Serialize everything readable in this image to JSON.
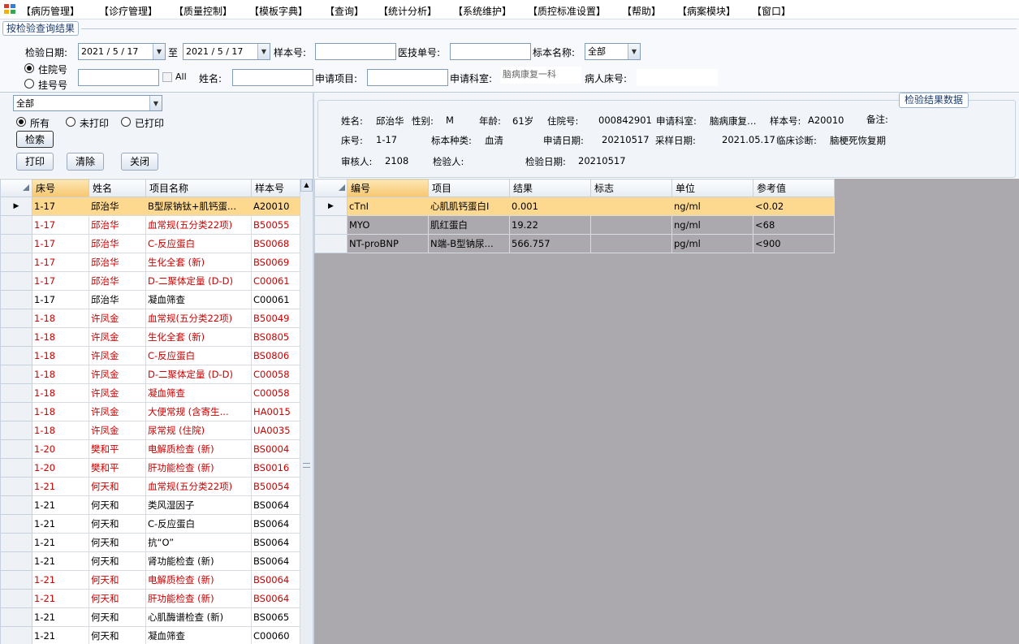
{
  "menu": [
    "【病历管理】",
    "【诊疗管理】",
    "【质量控制】",
    "【模板字典】",
    "【查询】",
    "【统计分析】",
    "【系统维护】",
    "【质控标准设置】",
    "【帮助】",
    "【病案模块】",
    "【窗口】"
  ],
  "query": {
    "group_title": "按检验查询结果",
    "date_label": "检验日期:",
    "date_from": "2021 / 5 / 17",
    "to_label": "至",
    "date_to": "2021 / 5 / 17",
    "sample_no_label": "样本号:",
    "sample_no_value": "",
    "tech_no_label": "医技单号:",
    "tech_no_value": "",
    "specimen_label": "标本名称:",
    "specimen_value": "全部",
    "inpatient_label": "住院号",
    "register_label": "挂号号",
    "all_label": "All",
    "name_label": "姓名:",
    "name_value": "",
    "apply_item_label": "申请项目:",
    "apply_item_value": "",
    "apply_dept_label": "申请科室:",
    "apply_dept_value": "脑病康复一科",
    "bed_label": "病人床号:",
    "bed_value": ""
  },
  "filter": {
    "combo_value": "全部",
    "all_label": "所有",
    "unprinted_label": "未打印",
    "printed_label": "已打印",
    "search_button": "检索",
    "print_button": "打印",
    "clear_button": "清除",
    "close_button": "关闭"
  },
  "detail": {
    "title": "检验结果数据",
    "name_label": "姓名:",
    "name": "邱治华",
    "sex_label": "性别:",
    "sex": "M",
    "age_label": "年龄:",
    "age": "61岁",
    "inpatient_label": "住院号:",
    "inpatient": "000842901",
    "dept_label": "申请科室:",
    "dept": "脑病康复…",
    "sample_label": "样本号:",
    "sample": "A20010",
    "remark_label": "备注:",
    "bed_label": "床号:",
    "bed": "1-17",
    "specimen_label": "标本种类:",
    "specimen": "血清",
    "apply_date_label": "申请日期:",
    "apply_date": "20210517",
    "collect_date_label": "采样日期:",
    "collect_date": "2021.05.17",
    "diagnosis_label": "临床诊断:",
    "diagnosis": "脑梗死恢复期",
    "reviewer_label": "审核人:",
    "reviewer": "2108",
    "tester_label": "检验人:",
    "tester": "",
    "test_date_label": "检验日期:",
    "test_date": "20210517"
  },
  "left_grid": {
    "columns": [
      "床号",
      "姓名",
      "项目名称",
      "样本号"
    ],
    "rows": [
      {
        "bed": "1-17",
        "name": "邱治华",
        "item": "B型尿钠钛+肌钙蛋...",
        "sample": "A20010",
        "red": false,
        "current": true
      },
      {
        "bed": "1-17",
        "name": "邱治华",
        "item": "血常规(五分类22项)",
        "sample": "B50055",
        "red": true
      },
      {
        "bed": "1-17",
        "name": "邱治华",
        "item": "C-反应蛋白",
        "sample": "BS0068",
        "red": true
      },
      {
        "bed": "1-17",
        "name": "邱治华",
        "item": "生化全套 (新)",
        "sample": "BS0069",
        "red": true
      },
      {
        "bed": "1-17",
        "name": "邱治华",
        "item": "D-二聚体定量 (D-D)",
        "sample": "C00061",
        "red": true
      },
      {
        "bed": "1-17",
        "name": "邱治华",
        "item": "凝血筛查",
        "sample": "C00061",
        "red": false
      },
      {
        "bed": "1-18",
        "name": "许凤金",
        "item": "血常规(五分类22项)",
        "sample": "B50049",
        "red": true
      },
      {
        "bed": "1-18",
        "name": "许凤金",
        "item": "生化全套 (新)",
        "sample": "BS0805",
        "red": true
      },
      {
        "bed": "1-18",
        "name": "许凤金",
        "item": "C-反应蛋白",
        "sample": "BS0806",
        "red": true
      },
      {
        "bed": "1-18",
        "name": "许凤金",
        "item": "D-二聚体定量 (D-D)",
        "sample": "C00058",
        "red": true
      },
      {
        "bed": "1-18",
        "name": "许凤金",
        "item": "凝血筛查",
        "sample": "C00058",
        "red": true
      },
      {
        "bed": "1-18",
        "name": "许凤金",
        "item": "大便常规 (含寄生...",
        "sample": "HA0015",
        "red": true
      },
      {
        "bed": "1-18",
        "name": "许凤金",
        "item": "尿常规 (住院)",
        "sample": "UA0035",
        "red": true
      },
      {
        "bed": "1-20",
        "name": "樊和平",
        "item": "电解质检查 (新)",
        "sample": "BS0004",
        "red": true
      },
      {
        "bed": "1-20",
        "name": "樊和平",
        "item": "肝功能检查 (新)",
        "sample": "BS0016",
        "red": true
      },
      {
        "bed": "1-21",
        "name": "何天和",
        "item": "血常规(五分类22项)",
        "sample": "B50054",
        "red": true
      },
      {
        "bed": "1-21",
        "name": "何天和",
        "item": "类风湿因子",
        "sample": "BS0064",
        "red": false
      },
      {
        "bed": "1-21",
        "name": "何天和",
        "item": "C-反应蛋白",
        "sample": "BS0064",
        "red": false
      },
      {
        "bed": "1-21",
        "name": "何天和",
        "item": "抗“O”",
        "sample": "BS0064",
        "red": false
      },
      {
        "bed": "1-21",
        "name": "何天和",
        "item": "肾功能检查 (新)",
        "sample": "BS0064",
        "red": false
      },
      {
        "bed": "1-21",
        "name": "何天和",
        "item": "电解质检查 (新)",
        "sample": "BS0064",
        "red": true
      },
      {
        "bed": "1-21",
        "name": "何天和",
        "item": "肝功能检查 (新)",
        "sample": "BS0064",
        "red": true
      },
      {
        "bed": "1-21",
        "name": "何天和",
        "item": "心肌酶谱检查 (新)",
        "sample": "BS0065",
        "red": false
      },
      {
        "bed": "1-21",
        "name": "何天和",
        "item": "凝血筛查",
        "sample": "C00060",
        "red": false
      }
    ]
  },
  "right_grid": {
    "columns": [
      "编号",
      "项目",
      "结果",
      "标志",
      "单位",
      "参考值"
    ],
    "rows": [
      {
        "code": "cTnI",
        "item": "心肌肌钙蛋白I",
        "result": "0.001",
        "flag": "",
        "unit": "ng/ml",
        "ref": "<0.02",
        "current": true
      },
      {
        "code": "MYO",
        "item": "肌红蛋白",
        "result": "19.22",
        "flag": "",
        "unit": "ng/ml",
        "ref": "<68"
      },
      {
        "code": "NT-proBNP",
        "item": "N端-B型钠尿...",
        "result": "566.757",
        "flag": "",
        "unit": "pg/ml",
        "ref": "<900"
      }
    ]
  }
}
